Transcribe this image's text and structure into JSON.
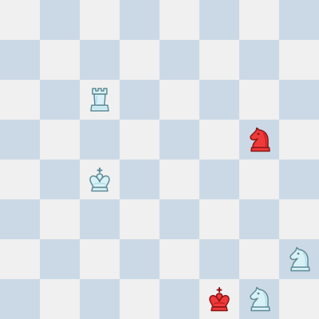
{
  "board": {
    "files": 8,
    "ranks": 8,
    "colors": {
      "light": "#f0f0f0",
      "dark": "#cbd9e6"
    },
    "piece_colors": {
      "white": {
        "fill": "#d8f1f6",
        "stroke": "#5d8a96",
        "shade": "#aee0ea"
      },
      "red": {
        "fill": "#ef3a3a",
        "stroke": "#8a1414",
        "shade": "#c91f1f"
      }
    },
    "pieces": [
      {
        "type": "rook",
        "color": "white",
        "square": "c6"
      },
      {
        "type": "knight",
        "color": "red",
        "square": "g5"
      },
      {
        "type": "king",
        "color": "white",
        "square": "c4"
      },
      {
        "type": "knight",
        "color": "white",
        "square": "h2"
      },
      {
        "type": "king",
        "color": "red",
        "square": "f1"
      },
      {
        "type": "knight",
        "color": "white",
        "square": "g1"
      }
    ]
  }
}
